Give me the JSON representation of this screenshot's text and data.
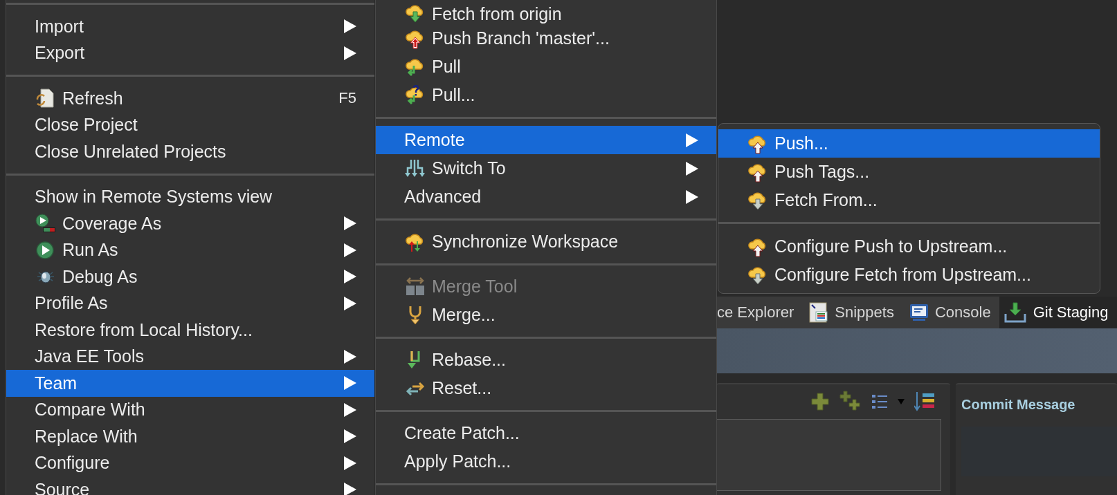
{
  "context_menu": {
    "items": [
      {
        "kind": "separator"
      },
      {
        "kind": "item",
        "label": "Import",
        "submenu": true,
        "selected": false,
        "disabled": false
      },
      {
        "kind": "item",
        "label": "Export",
        "submenu": true,
        "selected": false,
        "disabled": false
      },
      {
        "kind": "separator"
      },
      {
        "kind": "item",
        "label": "Refresh",
        "shortcut": "F5",
        "submenu": false,
        "selected": false,
        "disabled": false
      },
      {
        "kind": "item",
        "label": "Close Project",
        "submenu": false,
        "selected": false,
        "disabled": false
      },
      {
        "kind": "item",
        "label": "Close Unrelated Projects",
        "submenu": false,
        "selected": false,
        "disabled": false
      },
      {
        "kind": "separator"
      },
      {
        "kind": "item",
        "label": "Show in Remote Systems view",
        "submenu": false,
        "selected": false,
        "disabled": false
      },
      {
        "kind": "item",
        "label": "Coverage As",
        "submenu": true,
        "selected": false,
        "disabled": false
      },
      {
        "kind": "item",
        "label": "Run As",
        "submenu": true,
        "selected": false,
        "disabled": false
      },
      {
        "kind": "item",
        "label": "Debug As",
        "submenu": true,
        "selected": false,
        "disabled": false
      },
      {
        "kind": "item",
        "label": "Profile As",
        "submenu": true,
        "selected": false,
        "disabled": false
      },
      {
        "kind": "item",
        "label": "Restore from Local History...",
        "submenu": false,
        "selected": false,
        "disabled": false
      },
      {
        "kind": "item",
        "label": "Java EE Tools",
        "submenu": true,
        "selected": false,
        "disabled": false
      },
      {
        "kind": "item",
        "label": "Team",
        "submenu": true,
        "selected": true,
        "disabled": false
      },
      {
        "kind": "item",
        "label": "Compare With",
        "submenu": true,
        "selected": false,
        "disabled": false
      },
      {
        "kind": "item",
        "label": "Replace With",
        "submenu": true,
        "selected": false,
        "disabled": false
      },
      {
        "kind": "item",
        "label": "Configure",
        "submenu": true,
        "selected": false,
        "disabled": false
      },
      {
        "kind": "item",
        "label": "Source",
        "submenu": true,
        "selected": false,
        "disabled": false
      }
    ]
  },
  "team_submenu": {
    "items": [
      {
        "kind": "item",
        "label": "Fetch from origin",
        "submenu": false,
        "selected": false,
        "disabled": false
      },
      {
        "kind": "item",
        "label": "Push Branch 'master'...",
        "submenu": false,
        "selected": false,
        "disabled": false
      },
      {
        "kind": "item",
        "label": "Pull",
        "submenu": false,
        "selected": false,
        "disabled": false
      },
      {
        "kind": "item",
        "label": "Pull...",
        "submenu": false,
        "selected": false,
        "disabled": false
      },
      {
        "kind": "separator"
      },
      {
        "kind": "item",
        "label": "Remote",
        "submenu": true,
        "selected": true,
        "disabled": false
      },
      {
        "kind": "item",
        "label": "Switch To",
        "submenu": true,
        "selected": false,
        "disabled": false
      },
      {
        "kind": "item",
        "label": "Advanced",
        "submenu": true,
        "selected": false,
        "disabled": false
      },
      {
        "kind": "separator"
      },
      {
        "kind": "item",
        "label": "Synchronize Workspace",
        "submenu": false,
        "selected": false,
        "disabled": false
      },
      {
        "kind": "separator"
      },
      {
        "kind": "item",
        "label": "Merge Tool",
        "submenu": false,
        "selected": false,
        "disabled": true
      },
      {
        "kind": "item",
        "label": "Merge...",
        "submenu": false,
        "selected": false,
        "disabled": false
      },
      {
        "kind": "separator"
      },
      {
        "kind": "item",
        "label": "Rebase...",
        "submenu": false,
        "selected": false,
        "disabled": false
      },
      {
        "kind": "item",
        "label": "Reset...",
        "submenu": false,
        "selected": false,
        "disabled": false
      },
      {
        "kind": "separator"
      },
      {
        "kind": "item",
        "label": "Create Patch...",
        "submenu": false,
        "selected": false,
        "disabled": false
      },
      {
        "kind": "item",
        "label": "Apply Patch...",
        "submenu": false,
        "selected": false,
        "disabled": false
      },
      {
        "kind": "separator"
      }
    ]
  },
  "remote_submenu": {
    "items": [
      {
        "kind": "item",
        "label": "Push...",
        "submenu": false,
        "selected": true,
        "disabled": false
      },
      {
        "kind": "item",
        "label": "Push Tags...",
        "submenu": false,
        "selected": false,
        "disabled": false
      },
      {
        "kind": "item",
        "label": "Fetch From...",
        "submenu": false,
        "selected": false,
        "disabled": false
      },
      {
        "kind": "separator"
      },
      {
        "kind": "item",
        "label": "Configure Push to Upstream...",
        "submenu": false,
        "selected": false,
        "disabled": false
      },
      {
        "kind": "item",
        "label": "Configure Fetch from Upstream...",
        "submenu": false,
        "selected": false,
        "disabled": false
      }
    ]
  },
  "view_tabs": [
    {
      "label": "ce Explorer",
      "selected": false
    },
    {
      "label": "Snippets",
      "selected": false
    },
    {
      "label": "Console",
      "selected": false
    },
    {
      "label": "Git Staging",
      "selected": true
    }
  ],
  "commit_panel": {
    "title": "Commit Message"
  }
}
